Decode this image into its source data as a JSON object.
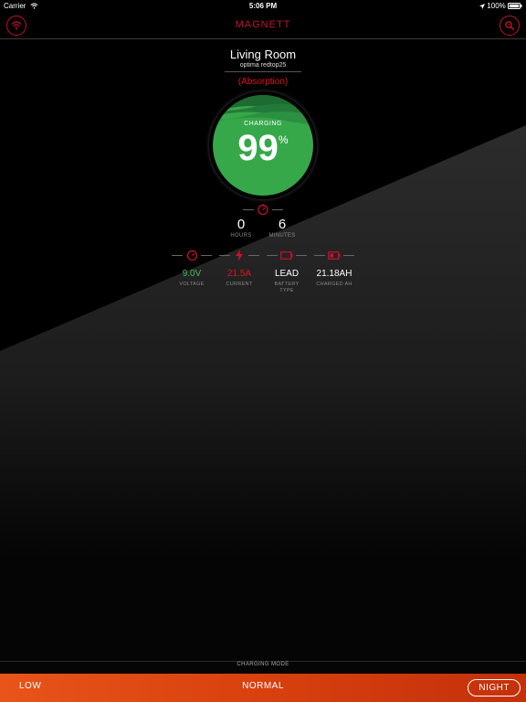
{
  "status_bar": {
    "carrier": "Carrier",
    "time": "5:06 PM",
    "battery": "100%"
  },
  "header": {
    "title": "MAGNETT"
  },
  "device": {
    "name": "Living Room",
    "model": "optima   redtop25",
    "stage": "(Absorption)"
  },
  "gauge": {
    "label": "CHARGING",
    "value": "99",
    "unit": "%",
    "percent": 99
  },
  "time_remaining": {
    "hours": {
      "value": "0",
      "label": "HOURS"
    },
    "minutes": {
      "value": "6",
      "label": "MINUTES"
    }
  },
  "stats": {
    "voltage": {
      "value": "9.0V",
      "label": "VOLTAGE",
      "color": "#3fbf58"
    },
    "current": {
      "value": "21.5A",
      "label": "CURRENT",
      "color": "#e0141e"
    },
    "battery_type": {
      "value": "LEAD",
      "label": "BATTERY TYPE",
      "color": "#ffffff"
    },
    "charged_ah": {
      "value": "21.18AH",
      "label": "CHARGED AH",
      "color": "#ffffff"
    }
  },
  "icons": {
    "wifi": "wifi-icon",
    "search": "search-icon",
    "timer": "timer-icon",
    "voltage": "gauge-icon",
    "current": "lightning-icon",
    "battery": "battery-icon",
    "charged": "battery-charge-icon"
  },
  "charging_mode": {
    "label": "CHARGING MODE",
    "options": {
      "low": "LOW",
      "normal": "NORMAL",
      "night": "NIGHT"
    },
    "selected": "NIGHT"
  },
  "colors": {
    "accent": "#c8102e",
    "gauge_green": "#36a84a",
    "mode_bar": "#d8400e"
  }
}
